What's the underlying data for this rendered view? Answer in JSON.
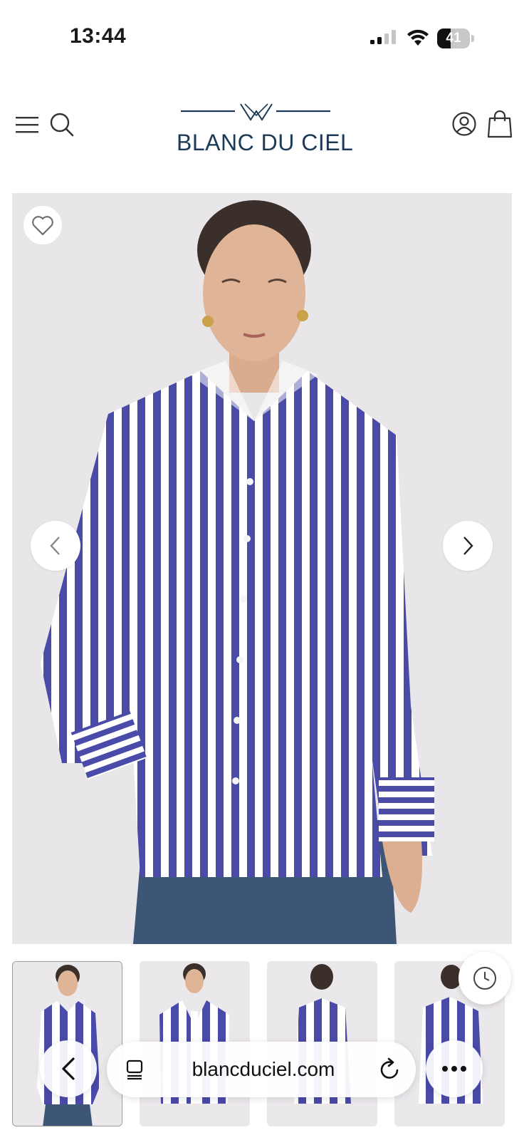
{
  "status_bar": {
    "time": "13:44",
    "battery_level": "41",
    "battery_fraction": 0.41
  },
  "header": {
    "brand_name": "BLANC DU CIEL",
    "brand_color": "#1c3a57",
    "icons": [
      "menu-icon",
      "search-icon",
      "account-icon",
      "shopping-bag-icon"
    ]
  },
  "product": {
    "stripe_color": "#4a4aa8",
    "background_color": "#e9e6e9",
    "image_count": 4,
    "current_image": 1
  },
  "browser": {
    "url": "blancduciel.com",
    "icons": [
      "back-arrow-icon",
      "tabs-icon",
      "reload-icon",
      "more-icon",
      "history-icon"
    ]
  }
}
